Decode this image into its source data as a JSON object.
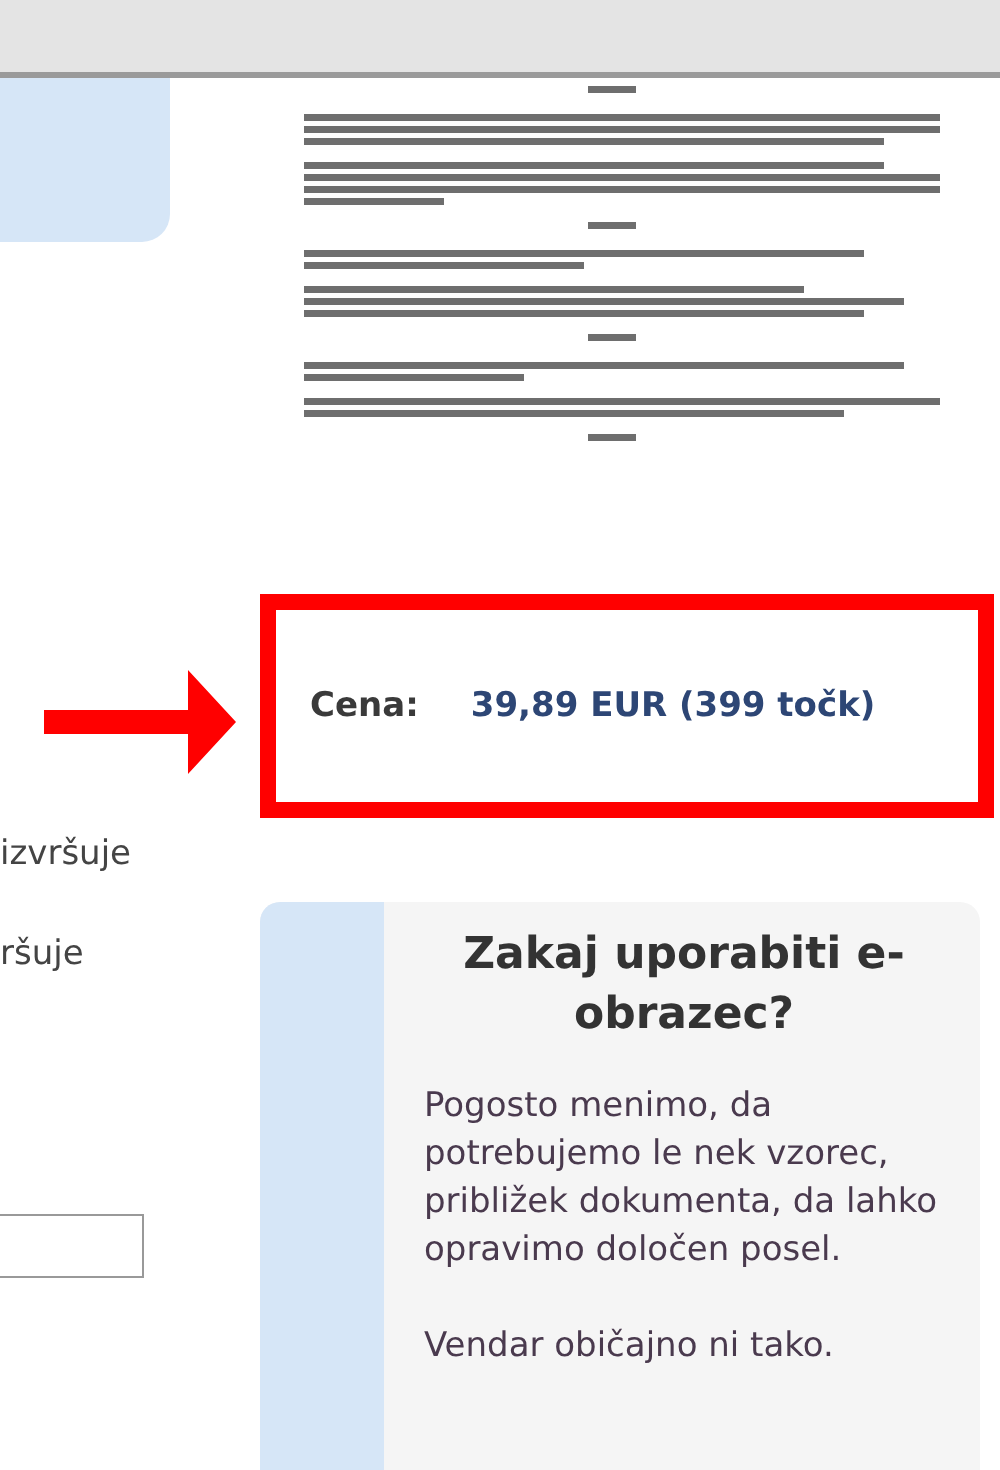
{
  "left_column": {
    "texts": [
      "izvršuje",
      "ršuje"
    ]
  },
  "price": {
    "label": "Cena:",
    "value": "39,89 EUR (399 točk)"
  },
  "info_card": {
    "title": "Zakaj uporabiti e-obrazec?",
    "paragraphs": [
      "Pogosto menimo, da potrebujemo le nek vzorec, približek dokumenta, da lahko opravimo določen posel.",
      "Vendar običajno ni tako."
    ]
  }
}
